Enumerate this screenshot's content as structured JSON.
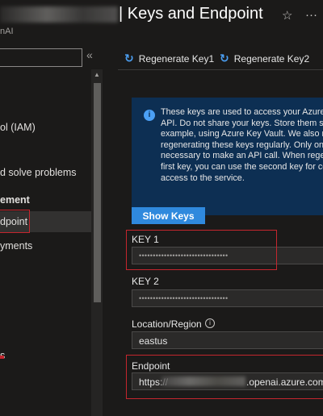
{
  "header": {
    "title": "| Keys and Endpoint",
    "subtitle": "nAI",
    "favorite_icon": "star-icon",
    "more_icon": "ellipsis-icon"
  },
  "sidebar": {
    "search_placeholder": "",
    "collapse_icon": "double-chevron-left-icon",
    "items": [
      {
        "label": "ol (IAM)"
      },
      {
        "label": "d solve problems"
      },
      {
        "label": "ement"
      },
      {
        "label": "dpoint"
      },
      {
        "label": "yments"
      },
      {
        "label": "s"
      }
    ]
  },
  "command_bar": {
    "regenerate_key1": "Regenerate Key1",
    "regenerate_key2": "Regenerate Key2"
  },
  "info": {
    "lines": [
      "These keys are used to access your Azure AI",
      "API. Do not share your keys. Store them sec",
      "example, using Azure Key Vault. We also rec",
      "regenerating these keys regularly. Only one",
      "necessary to make an API call. When regene",
      "first key, you can use the second key for con",
      "access to the service."
    ]
  },
  "show_keys_label": "Show Keys",
  "key1": {
    "label": "KEY 1",
    "value": "••••••••••••••••••••••••••••••••"
  },
  "key2": {
    "label": "KEY 2",
    "value": "••••••••••••••••••••••••••••••••"
  },
  "location": {
    "label": "Location/Region",
    "value": "eastus"
  },
  "endpoint": {
    "label": "Endpoint",
    "prefix": "https://",
    "suffix": ".openai.azure.com/"
  },
  "colors": {
    "accent": "#2f89dd",
    "info_bg": "#0d2f53",
    "highlight": "#c4262e"
  }
}
